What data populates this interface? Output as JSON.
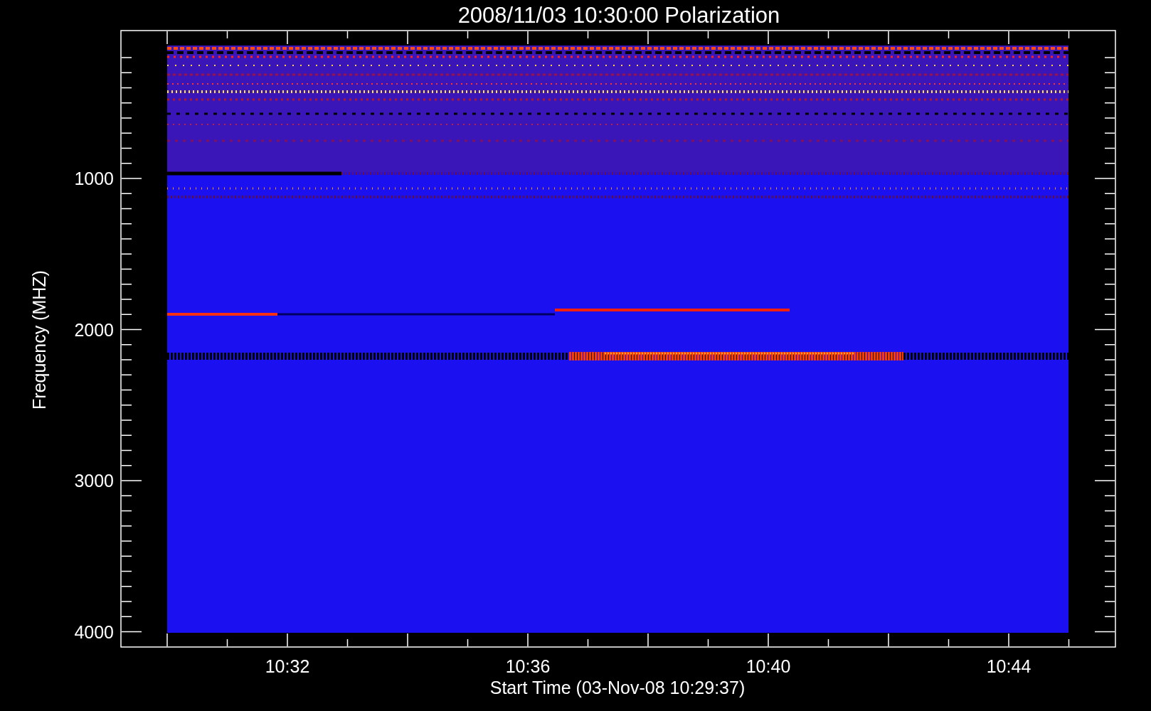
{
  "title": "2008/11/03 10:30:00 Polarization",
  "y_axis": {
    "label": "Frequency (MHZ)",
    "ticks": [
      "1000",
      "2000",
      "3000",
      "4000"
    ]
  },
  "x_axis": {
    "label": "Start Time (03-Nov-08 10:29:37)",
    "ticks": [
      "10:32",
      "10:36",
      "10:40",
      "10:44"
    ]
  }
}
